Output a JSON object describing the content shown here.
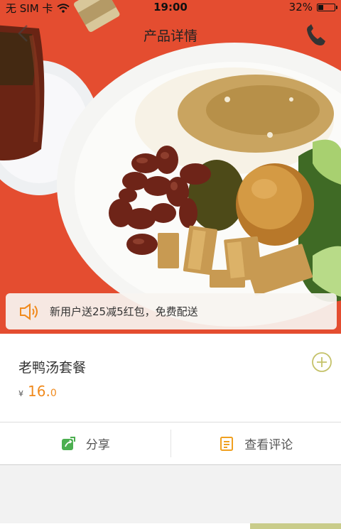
{
  "status_bar": {
    "carrier": "无 SIM 卡",
    "time": "19:00",
    "battery_percent": "32%",
    "battery_level": 0.32
  },
  "nav": {
    "title": "产品详情",
    "back_icon": "chevron-left-icon",
    "phone_icon": "phone-icon"
  },
  "promo": {
    "text": "新用户送25减5红包，免费配送",
    "icon": "speaker-icon"
  },
  "product": {
    "name": "老鸭汤套餐",
    "currency": "¥",
    "price_int": "16.",
    "price_dec": "0"
  },
  "actions": {
    "share_label": "分享",
    "reviews_label": "查看评论"
  },
  "colors": {
    "accent": "#f08a1d",
    "add_button": "#c5c26a",
    "share_icon": "#4caf50",
    "reviews_icon": "#f0a020"
  }
}
